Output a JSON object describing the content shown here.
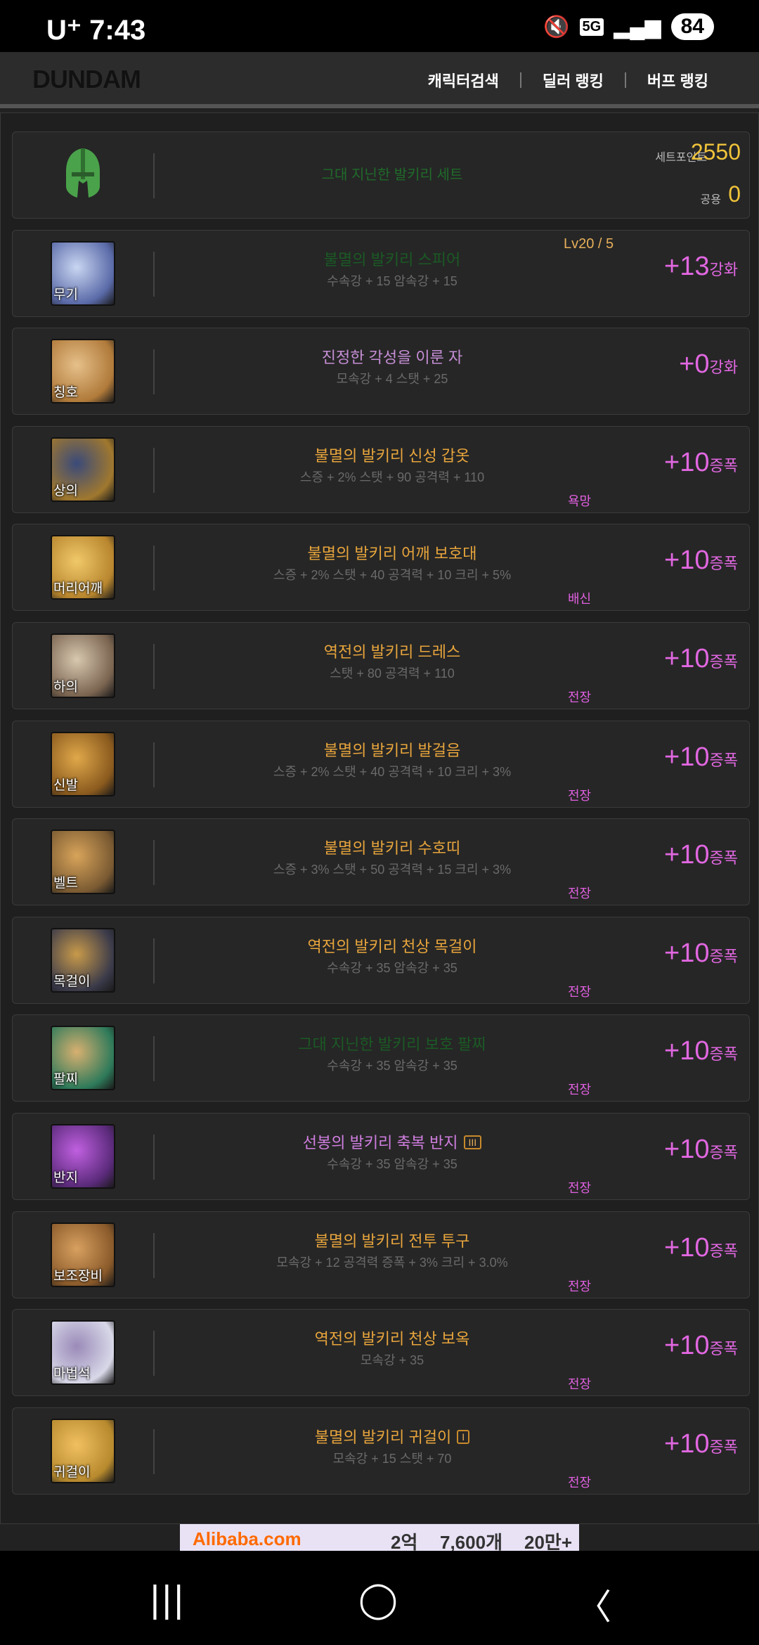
{
  "statusbar": {
    "carrier": "U⁺",
    "time": "7:43",
    "mute_icon": "mute-icon",
    "network": "5G",
    "signal_icon": "signal-icon",
    "battery": "84"
  },
  "header": {
    "logo": "DUNDAM",
    "nav": [
      "캐릭터검색",
      "딜러 랭킹",
      "버프 랭킹"
    ]
  },
  "set": {
    "name": "그대 지닌한 발키리 세트",
    "points_label": "세트포인트",
    "points": "2550",
    "common_label": "공용",
    "common": "0",
    "helmet_icon": "helmet-icon"
  },
  "items": [
    {
      "slot": "무기",
      "name": "불멸의 발키리 스피어",
      "stats": "수속강 + 15 암속강 + 15",
      "enhance": "+13",
      "unit": "강화",
      "tag": "",
      "level": "Lv20 / 5",
      "name_color": "#1a5a24"
    },
    {
      "slot": "칭호",
      "name": "진정한 각성을 이룬 자",
      "stats": "모속강 + 4 스탯 + 25",
      "enhance": "+0",
      "unit": "강화",
      "tag": "",
      "name_color": "#c68ed6"
    },
    {
      "slot": "상의",
      "name": "불멸의 발키리 신성 갑옷",
      "stats": "스증 + 2% 스탯 + 90 공격력 + 110",
      "enhance": "+10",
      "unit": "증폭",
      "tag": "욕망",
      "name_color": "#e8a53c"
    },
    {
      "slot": "머리어깨",
      "name": "불멸의 발키리 어깨 보호대",
      "stats": "스증 + 2% 스탯 + 40 공격력 + 10 크리 + 5%",
      "enhance": "+10",
      "unit": "증폭",
      "tag": "배신",
      "name_color": "#e8a53c"
    },
    {
      "slot": "하의",
      "name": "역전의 발키리 드레스",
      "stats": "스탯 + 80 공격력 + 110",
      "enhance": "+10",
      "unit": "증폭",
      "tag": "전장",
      "name_color": "#e8a53c"
    },
    {
      "slot": "신발",
      "name": "불멸의 발키리 발걸음",
      "stats": "스증 + 2% 스탯 + 40 공격력 + 10 크리 + 3%",
      "enhance": "+10",
      "unit": "증폭",
      "tag": "전장",
      "name_color": "#e8a53c"
    },
    {
      "slot": "벨트",
      "name": "불멸의 발키리 수호띠",
      "stats": "스증 + 3% 스탯 + 50 공격력 + 15 크리 + 3%",
      "enhance": "+10",
      "unit": "증폭",
      "tag": "전장",
      "name_color": "#e8a53c"
    },
    {
      "slot": "목걸이",
      "name": "역전의 발키리 천상 목걸이",
      "stats": "수속강 + 35 암속강 + 35",
      "enhance": "+10",
      "unit": "증폭",
      "tag": "전장",
      "name_color": "#e8a53c"
    },
    {
      "slot": "팔찌",
      "name": "그대 지닌한 발키리 보호 팔찌",
      "stats": "수속강 + 35 암속강 + 35",
      "enhance": "+10",
      "unit": "증폭",
      "tag": "전장",
      "name_color": "#1a5a24"
    },
    {
      "slot": "반지",
      "name": "선봉의 발키리 축복 반지",
      "mark": "III",
      "stats": "수속강 + 35 암속강 + 35",
      "enhance": "+10",
      "unit": "증폭",
      "tag": "전장",
      "name_color": "#d07ee0"
    },
    {
      "slot": "보조장비",
      "name": "불멸의 발키리 전투 투구",
      "stats": "모속강 + 12 공격력 증폭 + 3% 크리 + 3.0%",
      "enhance": "+10",
      "unit": "증폭",
      "tag": "전장",
      "name_color": "#e8a53c"
    },
    {
      "slot": "마법석",
      "name": "역전의 발키리 천상 보옥",
      "stats": "모속강 + 35",
      "enhance": "+10",
      "unit": "증폭",
      "tag": "전장",
      "name_color": "#e8a53c"
    },
    {
      "slot": "귀걸이",
      "name": "불멸의 발키리 귀걸이",
      "mark": "I",
      "stats": "모속강 + 15 스탯 + 70",
      "enhance": "+10",
      "unit": "증폭",
      "tag": "전장",
      "name_color": "#e8a53c"
    }
  ],
  "ad": {
    "brand": "Alibaba.com",
    "text1": "2억",
    "text2": "7,600개",
    "text3": "20만+"
  },
  "navbar": {
    "recents": "|||",
    "home": "◯",
    "back": "〈"
  }
}
